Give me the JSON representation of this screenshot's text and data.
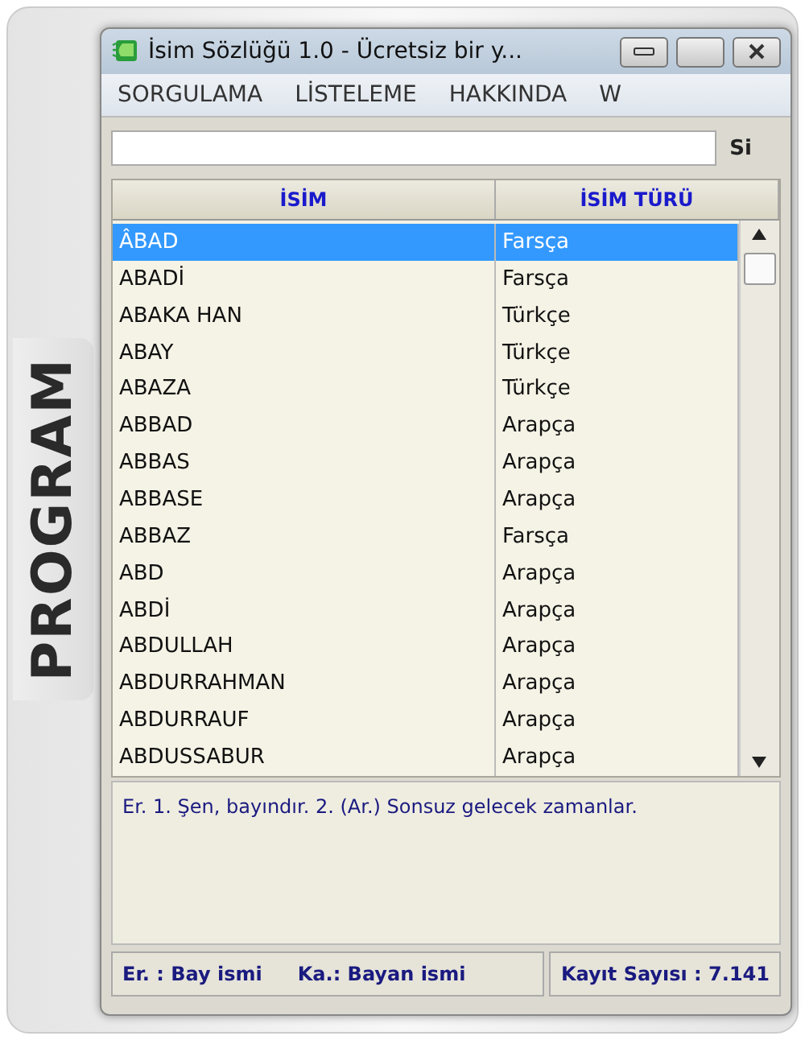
{
  "box_label": "PROGRAM",
  "window": {
    "title": "İsim Sözlüğü 1.0 - Ücretsiz bir y..."
  },
  "menu": [
    "SORGULAMA",
    "LİSTELEME",
    "HAKKINDA",
    "W"
  ],
  "search": {
    "button": "Si"
  },
  "list": {
    "columns": [
      "İSİM",
      "İSİM TÜRÜ"
    ],
    "rows": [
      {
        "name": "ÂBAD",
        "type": "Farsça",
        "selected": true
      },
      {
        "name": "ABADİ",
        "type": "Farsça",
        "selected": false
      },
      {
        "name": "ABAKA HAN",
        "type": "Türkçe",
        "selected": false
      },
      {
        "name": "ABAY",
        "type": "Türkçe",
        "selected": false
      },
      {
        "name": "ABAZA",
        "type": "Türkçe",
        "selected": false
      },
      {
        "name": "ABBAD",
        "type": "Arapça",
        "selected": false
      },
      {
        "name": "ABBAS",
        "type": "Arapça",
        "selected": false
      },
      {
        "name": "ABBASE",
        "type": "Arapça",
        "selected": false
      },
      {
        "name": "ABBAZ",
        "type": "Farsça",
        "selected": false
      },
      {
        "name": "ABD",
        "type": "Arapça",
        "selected": false
      },
      {
        "name": "ABDİ",
        "type": "Arapça",
        "selected": false
      },
      {
        "name": "ABDULLAH",
        "type": "Arapça",
        "selected": false
      },
      {
        "name": "ABDURRAHMAN",
        "type": "Arapça",
        "selected": false
      },
      {
        "name": "ABDURRAUF",
        "type": "Arapça",
        "selected": false
      },
      {
        "name": "ABDUSSABUR",
        "type": "Arapça",
        "selected": false
      }
    ]
  },
  "description": "Er. 1. Şen, bayındır. 2. (Ar.) Sonsuz gelecek zamanlar.",
  "status_bar": {
    "legend": [
      "Er. : Bay ismi",
      "Ka.: Bayan ismi"
    ],
    "count": "Kayıt Sayısı : 7.141"
  }
}
